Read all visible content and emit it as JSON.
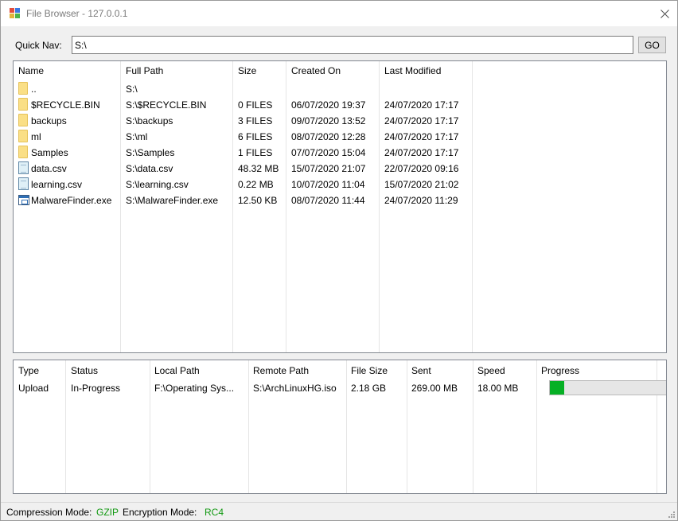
{
  "window": {
    "title": "File Browser - 127.0.0.1"
  },
  "quick_nav": {
    "label": "Quick Nav:",
    "value": "S:\\",
    "go_label": "GO"
  },
  "files": {
    "headers": [
      "Name",
      "Full Path",
      "Size",
      "Created On",
      "Last Modified"
    ],
    "rows": [
      {
        "icon": "folder-icon",
        "name": "..",
        "path": "S:\\",
        "size": "",
        "created": "",
        "modified": ""
      },
      {
        "icon": "folder-icon",
        "name": "$RECYCLE.BIN",
        "path": "S:\\$RECYCLE.BIN",
        "size": "0 FILES",
        "created": "06/07/2020 19:37",
        "modified": "24/07/2020 17:17"
      },
      {
        "icon": "folder-icon",
        "name": "backups",
        "path": "S:\\backups",
        "size": "3 FILES",
        "created": "09/07/2020 13:52",
        "modified": "24/07/2020 17:17"
      },
      {
        "icon": "folder-icon",
        "name": "ml",
        "path": "S:\\ml",
        "size": "6 FILES",
        "created": "08/07/2020 12:28",
        "modified": "24/07/2020 17:17"
      },
      {
        "icon": "folder-icon",
        "name": "Samples",
        "path": "S:\\Samples",
        "size": "1 FILES",
        "created": "07/07/2020 15:04",
        "modified": "24/07/2020 17:17"
      },
      {
        "icon": "file-icon",
        "name": "data.csv",
        "path": "S:\\data.csv",
        "size": "48.32 MB",
        "created": "15/07/2020 21:07",
        "modified": "22/07/2020 09:16"
      },
      {
        "icon": "file-icon",
        "name": "learning.csv",
        "path": "S:\\learning.csv",
        "size": "0.22 MB",
        "created": "10/07/2020 11:04",
        "modified": "15/07/2020 21:02"
      },
      {
        "icon": "exe-icon",
        "name": "MalwareFinder.exe",
        "path": "S:\\MalwareFinder.exe",
        "size": "12.50 KB",
        "created": "08/07/2020 11:44",
        "modified": "24/07/2020 11:29"
      }
    ]
  },
  "transfers": {
    "headers": [
      "Type",
      "Status",
      "Local Path",
      "Remote Path",
      "File Size",
      "Sent",
      "Speed",
      "Progress"
    ],
    "rows": [
      {
        "type": "Upload",
        "status": "In-Progress",
        "local": "F:\\Operating Sys...",
        "remote": "S:\\ArchLinuxHG.iso",
        "file_size": "2.18 GB",
        "sent": "269.00 MB",
        "speed": "18.00 MB",
        "progress": 0.12
      }
    ]
  },
  "status_bar": {
    "compression_label": "Compression Mode:",
    "compression_value": "GZIP",
    "encryption_label": "Encryption Mode:",
    "encryption_value": "RC4"
  },
  "colors": {
    "accent_green": "#119911",
    "progress_green": "#06b025",
    "folder_yellow": "#fadf86"
  }
}
